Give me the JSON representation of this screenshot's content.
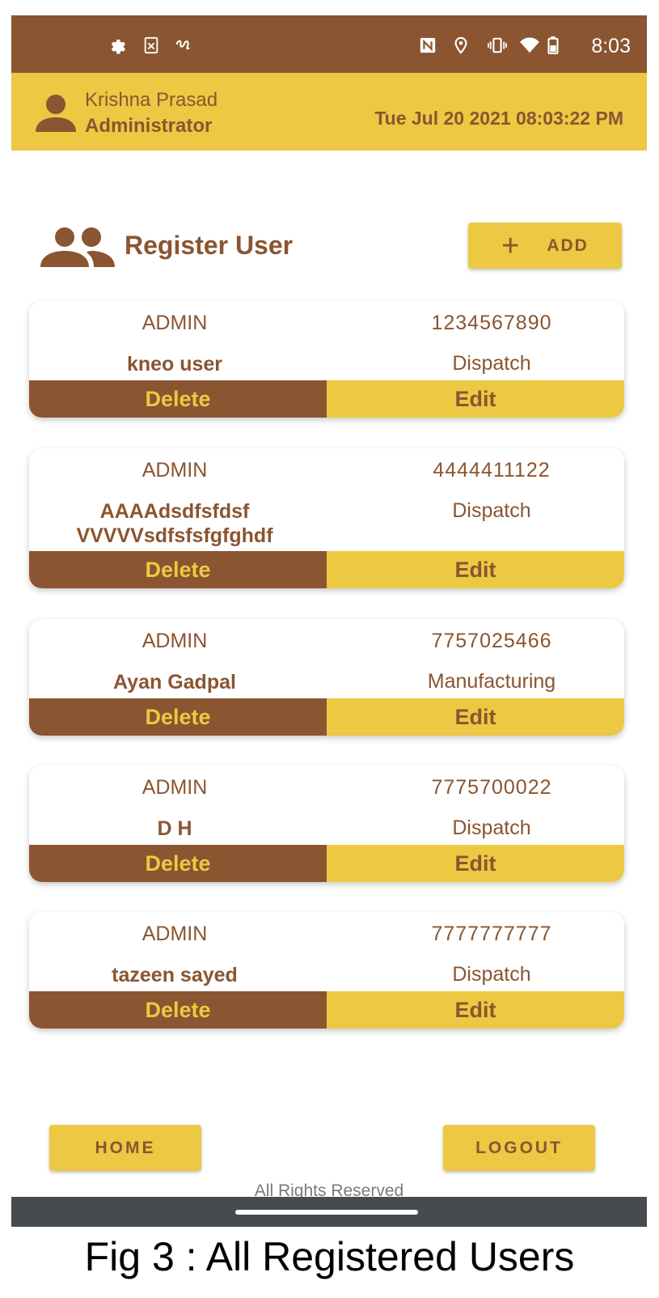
{
  "status_bar": {
    "time": "8:03",
    "left_icons": [
      "gear-icon",
      "sim-x-icon",
      "link-icon"
    ],
    "right_icons": [
      "nfc-icon",
      "location-pin-icon",
      "vibrate-icon",
      "wifi-icon",
      "battery-icon"
    ]
  },
  "header": {
    "user_name": "Krishna Prasad",
    "role": "Administrator",
    "datetime": "Tue Jul 20 2021 08:03:22 PM"
  },
  "page": {
    "title": "Register User",
    "add_label": "ADD"
  },
  "users": [
    {
      "role": "ADMIN",
      "phone": "1234567890",
      "name": "kneo user",
      "department": "Dispatch"
    },
    {
      "role": "ADMIN",
      "phone": "4444411122",
      "name": "AAAAdsdfsfdsf VVVVVsdfsfsfgfghdf",
      "department": "Dispatch"
    },
    {
      "role": "ADMIN",
      "phone": "7757025466",
      "name": "Ayan Gadpal",
      "department": "Manufacturing"
    },
    {
      "role": "ADMIN",
      "phone": "7775700022",
      "name": "D H",
      "department": "Dispatch"
    },
    {
      "role": "ADMIN",
      "phone": "7777777777",
      "name": "tazeen sayed",
      "department": "Dispatch"
    }
  ],
  "actions": {
    "delete_label": "Delete",
    "edit_label": "Edit"
  },
  "footer": {
    "home_label": "HOME",
    "logout_label": "LOGOUT",
    "rights": "All Rights Reserved"
  },
  "caption": "Fig 3 : All Registered Users",
  "colors": {
    "brown": "#8a5530",
    "yellow": "#ecc843",
    "nav": "#464b4f"
  }
}
